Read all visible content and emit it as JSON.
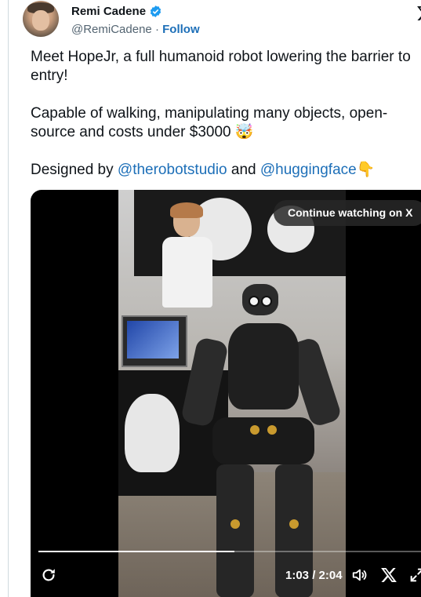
{
  "author": {
    "name": "Remi Cadene",
    "handle": "@RemiCadene",
    "separator": "·",
    "follow_label": "Follow",
    "verified": true
  },
  "tweet": {
    "paragraph1": "Meet HopeJr, a full humanoid robot lowering the barrier to entry!",
    "paragraph2_text": "Capable of walking, manipulating many objects, open-source and costs under $3000 ",
    "paragraph2_emoji": "🤯",
    "designed_prefix": "Designed by ",
    "mention1": "@therobotstudio",
    "designed_and": " and ",
    "mention2": "@huggingface",
    "designed_emoji": "👇"
  },
  "video": {
    "continue_label": "Continue watching on X",
    "time_current": "1:03",
    "time_sep": " / ",
    "time_total": "2:04",
    "progress_fraction": 0.508
  },
  "icons": {
    "brand": "x-logo-icon",
    "verified": "verified-badge-icon",
    "replay": "replay-icon",
    "volume": "volume-icon",
    "x_small": "x-logo-icon",
    "fullscreen": "expand-icon"
  },
  "colors": {
    "link": "#1d6fb8",
    "text": "#0f1419",
    "muted": "#536471",
    "verified": "#1d9bf0"
  }
}
